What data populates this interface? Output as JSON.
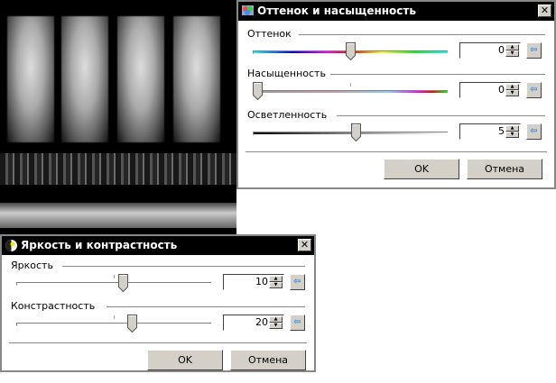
{
  "hue_dialog": {
    "title": "Оттенок и насыщенность",
    "close": "✕",
    "rows": [
      {
        "label": "Оттенок",
        "value": "0",
        "fraction": 0.5
      },
      {
        "label": "Насыщенность",
        "value": "0",
        "fraction": 0.0
      },
      {
        "label": "Осветленность",
        "value": "5",
        "fraction": 0.53
      }
    ],
    "ok": "OK",
    "cancel": "Отмена"
  },
  "bc_dialog": {
    "title": "Яркость и контрастность",
    "close": "✕",
    "rows": [
      {
        "label": "Яркость",
        "value": "10",
        "fraction": 0.55
      },
      {
        "label": "Констрастность",
        "value": "20",
        "fraction": 0.6
      }
    ],
    "ok": "OK",
    "cancel": "Отмена"
  },
  "icons": {
    "reset": "⇦",
    "up": "▲",
    "down": "▼"
  }
}
